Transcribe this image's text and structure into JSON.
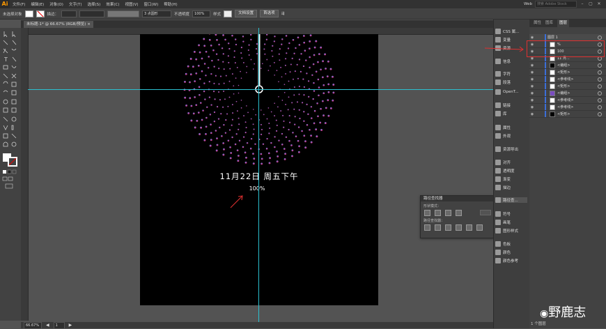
{
  "menu": {
    "logo": "Ai",
    "items": [
      "文件(F)",
      "编辑(E)",
      "对象(O)",
      "文字(T)",
      "选择(S)",
      "效果(C)",
      "视图(V)",
      "窗口(W)",
      "帮助(H)"
    ],
    "workspace": "Web",
    "search_placeholder": "搜索 Adobe Stock"
  },
  "control": {
    "selection": "未选择对象",
    "stroke_label": "描边：",
    "brush": "3 点圆形",
    "opacity_label": "不透明度",
    "opacity_value": "100%",
    "style_label": "样式",
    "doc_settings": "文档设置",
    "preferences": "首选项"
  },
  "document": {
    "tab": "未标题-1* @ 66.67% (RGB/预览)",
    "zoom": "66.67%",
    "page": "1"
  },
  "artwork": {
    "date": "11月22日  周五下午",
    "percent": "100%"
  },
  "dock": {
    "items": [
      "CSS 属...",
      "变量",
      "资源",
      "信息",
      "字符",
      "段落",
      "OpenT...",
      "链接",
      "库",
      "属性",
      "外观",
      "资源导出",
      "对齐",
      "透明度",
      "渐变",
      "描边",
      "路径查...",
      "符号",
      "画笔",
      "图形样式",
      "色板",
      "颜色",
      "颜色参考"
    ]
  },
  "layers": {
    "tabs": [
      "属性",
      "图库",
      "图层"
    ],
    "rows": [
      "图层 1",
      "%",
      "100",
      "11 月...",
      "<编组>",
      "<矩形>",
      "<参考线>",
      "<矩形>",
      "<编组>",
      "<参考线>",
      "<参考线>",
      "<矩形>"
    ],
    "footer": "1 个图层"
  },
  "pathfinder": {
    "title": "路径查找器",
    "shape_modes": "形状模式：",
    "pathfinders": "路径查找器："
  },
  "watermark": "野鹿志",
  "colors": {
    "accent": "#3b6ed8",
    "guide": "#2bc0d0",
    "annotation": "#e03030"
  }
}
